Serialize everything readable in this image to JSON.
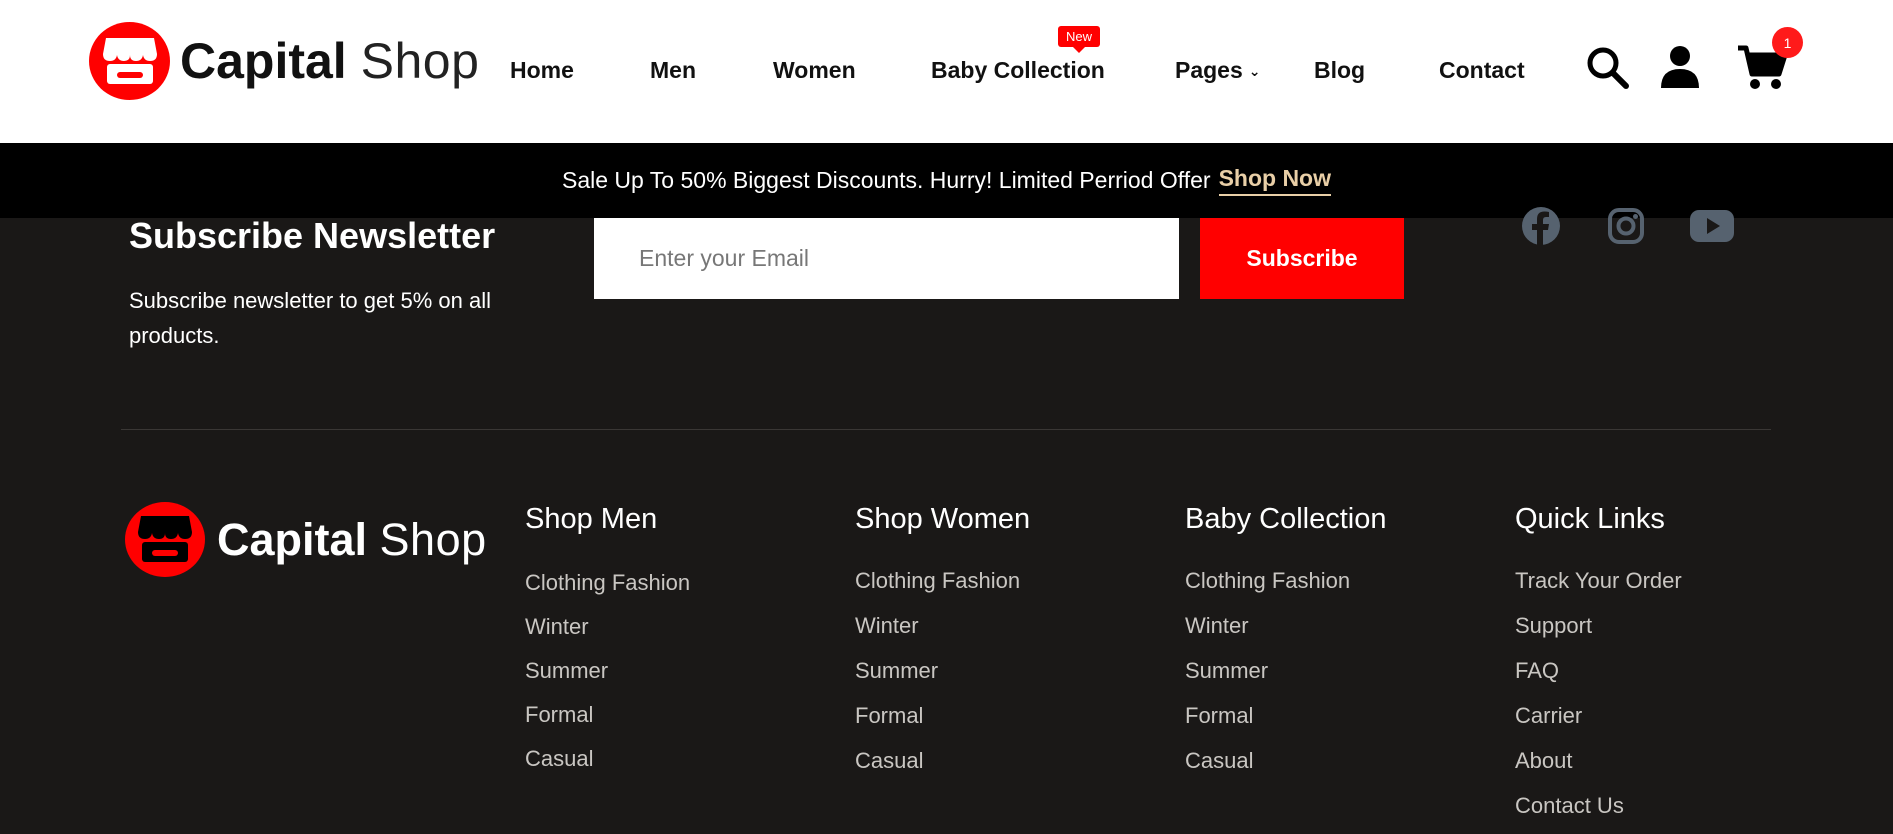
{
  "brand": {
    "name_bold": "Capital",
    "name_light": "Shop",
    "accent": "#ff0000"
  },
  "nav": {
    "items": [
      {
        "label": "Home"
      },
      {
        "label": "Men"
      },
      {
        "label": "Women"
      },
      {
        "label": "Baby Collection",
        "badge": "New"
      },
      {
        "label": "Pages"
      },
      {
        "label": "Blog"
      },
      {
        "label": "Contact"
      }
    ],
    "icons": [
      "search-icon",
      "user-icon",
      "cart-icon"
    ],
    "cart_count": "1"
  },
  "promo": {
    "text": "Sale Up To 50% Biggest Discounts. Hurry! Limited Perriod Offer",
    "link": "Shop Now",
    "link_color": "#e9cfa7"
  },
  "newsletter": {
    "title": "Subscribe Newsletter",
    "description": "Subscribe newsletter to get 5% on all products.",
    "placeholder": "Enter your Email",
    "button": "Subscribe"
  },
  "social": [
    "facebook-icon",
    "instagram-icon",
    "youtube-icon"
  ],
  "footer": {
    "columns": [
      {
        "title": "Shop Men",
        "links": [
          "Clothing Fashion",
          "Winter",
          "Summer",
          "Formal",
          "Casual"
        ]
      },
      {
        "title": "Shop Women",
        "links": [
          "Clothing Fashion",
          "Winter",
          "Summer",
          "Formal",
          "Casual"
        ]
      },
      {
        "title": "Baby Collection",
        "links": [
          "Clothing Fashion",
          "Winter",
          "Summer",
          "Formal",
          "Casual"
        ]
      },
      {
        "title": "Quick Links",
        "links": [
          "Track Your Order",
          "Support",
          "FAQ",
          "Carrier",
          "About",
          "Contact Us"
        ]
      }
    ]
  }
}
